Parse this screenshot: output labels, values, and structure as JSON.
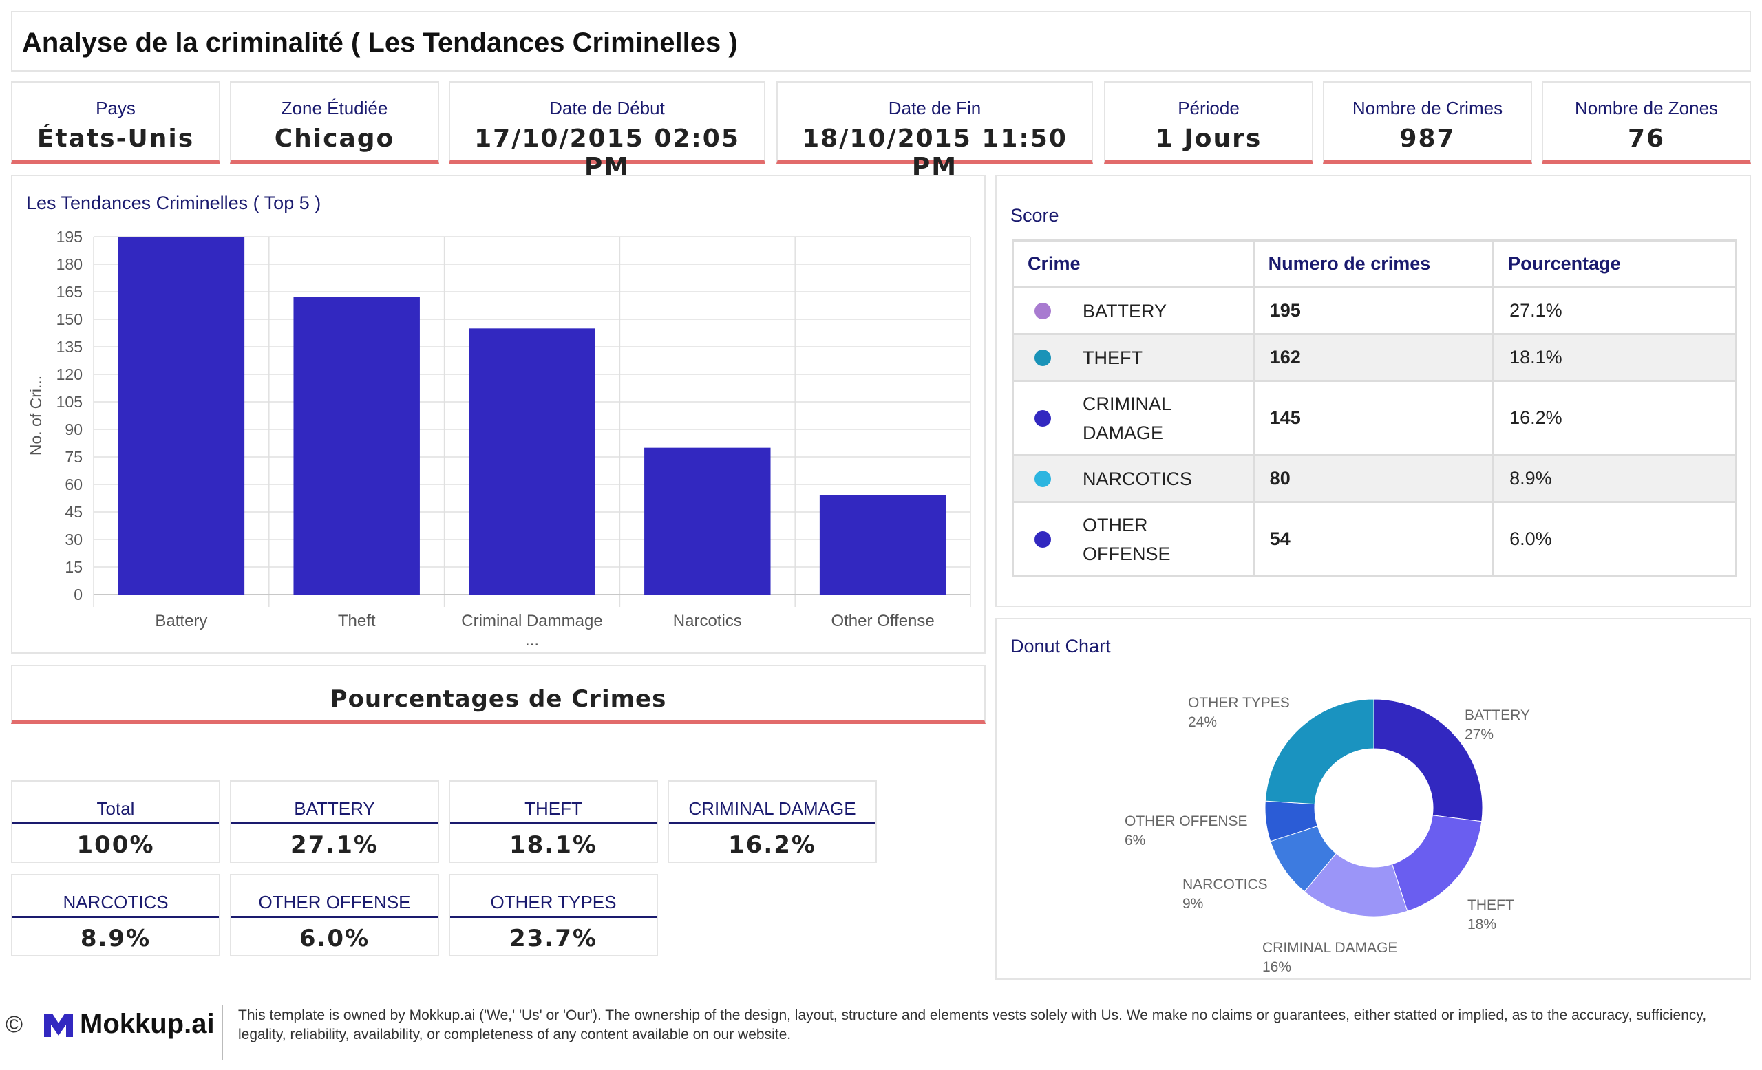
{
  "title": "Analyse de la criminalité ( Les Tendances Criminelles )",
  "kpis": [
    {
      "label": "Pays",
      "value": "États-Unis"
    },
    {
      "label": "Zone Étudiée",
      "value": "Chicago"
    },
    {
      "label": "Date de Début",
      "value": "17/10/2015 02:05 PM"
    },
    {
      "label": "Date de Fin",
      "value": "18/10/2015 11:50 PM"
    },
    {
      "label": "Période",
      "value": "1 Jours"
    },
    {
      "label": "Nombre de Crimes",
      "value": "987"
    },
    {
      "label": "Nombre de Zones",
      "value": "76"
    }
  ],
  "bar_panel": {
    "title": "Les Tendances Criminelles ( Top 5 )"
  },
  "percentages": {
    "title": "Pourcentages de Crimes",
    "cards": [
      {
        "label": "Total",
        "value": "100%"
      },
      {
        "label": "BATTERY",
        "value": "27.1%"
      },
      {
        "label": "THEFT",
        "value": "18.1%"
      },
      {
        "label": "CRIMINAL DAMAGE",
        "value": "16.2%"
      },
      {
        "label": "NARCOTICS",
        "value": "8.9%"
      },
      {
        "label": "OTHER OFFENSE",
        "value": "6.0%"
      },
      {
        "label": "OTHER TYPES",
        "value": "23.7%"
      }
    ]
  },
  "score": {
    "title": "Score",
    "headers": [
      "Crime",
      "Numero de crimes",
      "Pourcentage"
    ],
    "rows": [
      {
        "crime": "BATTERY",
        "count": "195",
        "pct": "27.1%",
        "color": "#a87bd0"
      },
      {
        "crime": "THEFT",
        "count": "162",
        "pct": "18.1%",
        "color": "#1a93b8"
      },
      {
        "crime": "CRIMINAL DAMAGE",
        "count": "145",
        "pct": "16.2%",
        "color": "#3228c0"
      },
      {
        "crime": "NARCOTICS",
        "count": "80",
        "pct": "8.9%",
        "color": "#2cb5e0"
      },
      {
        "crime": "OTHER OFFENSE",
        "count": "54",
        "pct": "6.0%",
        "color": "#3228c0"
      }
    ]
  },
  "donut_panel": {
    "title": "Donut Chart"
  },
  "chart_data": [
    {
      "type": "bar",
      "title": "Les Tendances Criminelles ( Top 5 )",
      "categories": [
        "Battery",
        "Theft",
        "Criminal Dammage ...",
        "Narcotics",
        "Other Offense"
      ],
      "values": [
        195,
        162,
        145,
        80,
        54
      ],
      "ylabel": "No. of Cri...",
      "xlabel": "",
      "ylim": [
        0,
        195
      ],
      "yticks": [
        0,
        15,
        30,
        45,
        60,
        75,
        90,
        105,
        120,
        135,
        150,
        165,
        180,
        195
      ],
      "grid": true,
      "color": "#3228c0"
    },
    {
      "type": "pie",
      "title": "Donut Chart",
      "slices": [
        {
          "label": "BATTERY",
          "pct_label": "27%",
          "value": 27,
          "color": "#3228c0"
        },
        {
          "label": "THEFT",
          "pct_label": "18%",
          "value": 18,
          "color": "#6a5ef0"
        },
        {
          "label": "CRIMINAL DAMAGE",
          "pct_label": "16%",
          "value": 16,
          "color": "#9b95f8"
        },
        {
          "label": "NARCOTICS",
          "pct_label": "9%",
          "value": 9,
          "color": "#3d7be0"
        },
        {
          "label": "OTHER OFFENSE",
          "pct_label": "6%",
          "value": 6,
          "color": "#2b5cd6"
        },
        {
          "label": "OTHER TYPES",
          "pct_label": "24%",
          "value": 24,
          "color": "#1a93c0"
        }
      ]
    }
  ],
  "footer": {
    "copyright": "©",
    "brand": "Mokkup.ai",
    "legal": "This template is owned by Mokkup.ai ('We,' 'Us' or 'Our'). The ownership of the design, layout, structure and elements vests solely with Us. We make no claims or guarantees, either statted or implied, as to the accuracy, sufficiency, legality, reliability, availability, or completeness of any content available on our website."
  }
}
